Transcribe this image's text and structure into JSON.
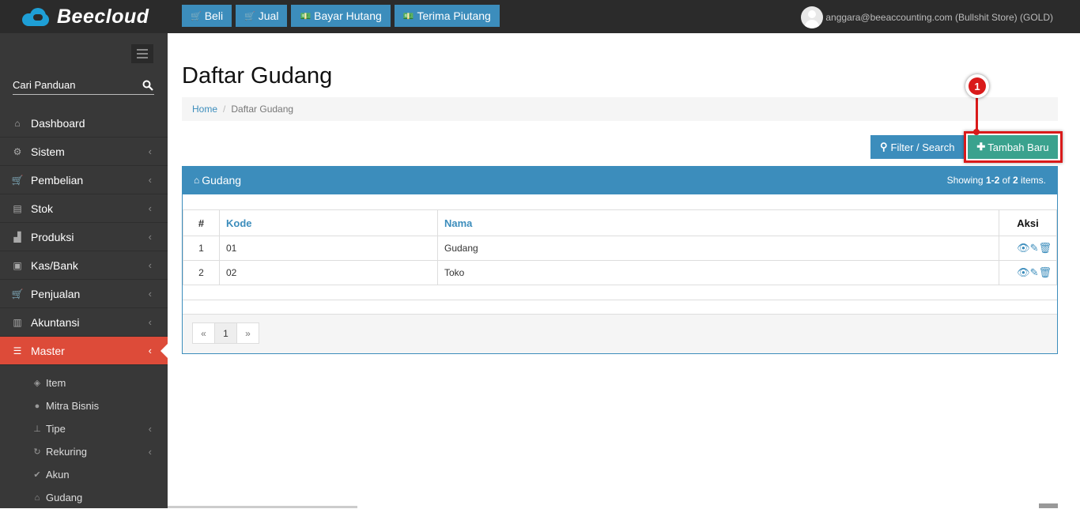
{
  "app": {
    "logo_text": "Beecloud"
  },
  "topnav": [
    {
      "label": "Beli",
      "icon": "cart-icon"
    },
    {
      "label": "Jual",
      "icon": "cart-icon"
    },
    {
      "label": "Bayar Hutang",
      "icon": "money-icon"
    },
    {
      "label": "Terima Piutang",
      "icon": "money-icon"
    }
  ],
  "user": {
    "label": "anggara@beeaccounting.com (Bullshit Store) (GOLD)"
  },
  "sidebar": {
    "search_label": "Cari Panduan",
    "items": [
      {
        "label": "Dashboard",
        "icon": "dashboard-icon"
      },
      {
        "label": "Sistem",
        "icon": "gears-icon"
      },
      {
        "label": "Pembelian",
        "icon": "cart-icon"
      },
      {
        "label": "Stok",
        "icon": "archive-icon"
      },
      {
        "label": "Produksi",
        "icon": "industry-icon"
      },
      {
        "label": "Kas/Bank",
        "icon": "money-icon"
      },
      {
        "label": "Penjualan",
        "icon": "cart-icon"
      },
      {
        "label": "Akuntansi",
        "icon": "bar-chart-icon"
      },
      {
        "label": "Master",
        "icon": "database-icon"
      }
    ],
    "subitems": [
      {
        "label": "Item",
        "icon": "cube-icon"
      },
      {
        "label": "Mitra Bisnis",
        "icon": "users-icon"
      },
      {
        "label": "Tipe",
        "icon": "sitemap-icon"
      },
      {
        "label": "Rekuring",
        "icon": "refresh-icon"
      },
      {
        "label": "Akun",
        "icon": "check-icon"
      },
      {
        "label": "Gudang",
        "icon": "home-icon"
      }
    ]
  },
  "page": {
    "title": "Daftar Gudang",
    "breadcrumb": {
      "home": "Home",
      "current": "Daftar Gudang"
    },
    "filter_label": "Filter / Search",
    "add_label": "Tambah Baru",
    "marker_number": "1"
  },
  "panel": {
    "title": "Gudang",
    "showing_prefix": "Showing ",
    "showing_range": "1-2",
    "showing_of": " of ",
    "showing_total": "2",
    "showing_suffix": " items."
  },
  "table": {
    "headers": {
      "num": "#",
      "kode": "Kode",
      "nama": "Nama",
      "aksi": "Aksi"
    },
    "rows": [
      {
        "num": "1",
        "kode": "01",
        "nama": "Gudang"
      },
      {
        "num": "2",
        "kode": "02",
        "nama": "Toko"
      }
    ]
  },
  "pager": {
    "prev": "«",
    "current": "1",
    "next": "»"
  },
  "colors": {
    "primary": "#3c8dbc",
    "success": "#3aa28e",
    "danger": "#dd4b39",
    "sidebar": "#383838"
  }
}
